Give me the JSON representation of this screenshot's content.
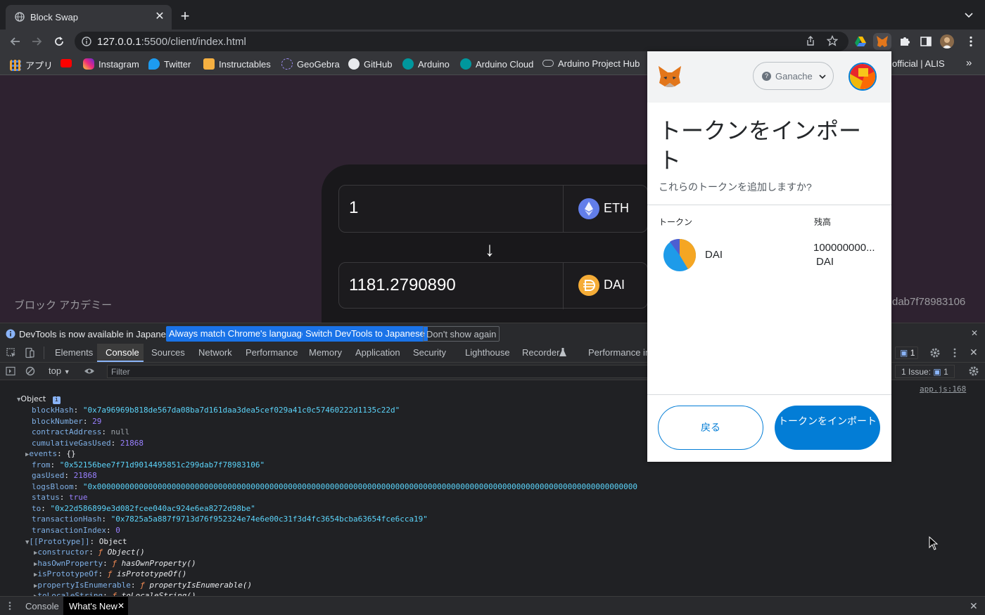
{
  "browser": {
    "tab_title": "Block Swap",
    "url_host": "127.0.0.1",
    "url_path": ":5500/client/index.html",
    "bookmarks": [
      "アプリ",
      "Instagram",
      "Twitter",
      "Instructables",
      "GeoGebra",
      "GitHub",
      "Arduino",
      "Arduino Cloud",
      "Arduino Project Hub"
    ],
    "bookmark_tail": "official | ALIS",
    "bookmark_overflow": "»"
  },
  "page": {
    "from_amount": "1",
    "from_token": "ETH",
    "to_amount": "1181.2790890",
    "to_token": "DAI",
    "brand": "ブロック アカデミー",
    "account_tail": "dab7f78983106",
    "swap_arrow": "↓"
  },
  "infobar": {
    "message": "DevTools is now available in Japanese!",
    "btn_match": "Always match Chrome's language",
    "btn_switch": "Switch DevTools to Japanese",
    "btn_dismiss": "Don't show again"
  },
  "devtools": {
    "tabs": [
      "Elements",
      "Console",
      "Sources",
      "Network",
      "Performance",
      "Memory",
      "Application",
      "Security",
      "Lighthouse",
      "Recorder",
      "Performance ins"
    ],
    "active_tab": "Console",
    "issues_badge": "1",
    "context": "top",
    "filter_placeholder": "Filter",
    "issues_text": "1 Issue:",
    "issues_count": "1",
    "source_link": "app.js:168",
    "object_label": "Object",
    "entries": [
      {
        "key": "blockHash",
        "val": "\"0x7a96969b818de567da08ba7d161daa3dea5cef029a41c0c57460222d1135c22d\"",
        "t": "s"
      },
      {
        "key": "blockNumber",
        "val": "29",
        "t": "n"
      },
      {
        "key": "contractAddress",
        "val": "null",
        "t": "nl"
      },
      {
        "key": "cumulativeGasUsed",
        "val": "21868",
        "t": "n"
      },
      {
        "key": "events",
        "val": "{}",
        "t": "ob"
      },
      {
        "key": "from",
        "val": "\"0x52156bee7f71d9014495851c299dab7f78983106\"",
        "t": "s"
      },
      {
        "key": "gasUsed",
        "val": "21868",
        "t": "n"
      },
      {
        "key": "logsBloom",
        "val": "\"0x00000000000000000000000000000000000000000000000000000000000000000000000000000000000000000000000000000000000000000000",
        "t": "s"
      },
      {
        "key": "status",
        "val": "true",
        "t": "n"
      },
      {
        "key": "to",
        "val": "\"0x22d586899e3d082fcee040ac924e6ea8272d98be\"",
        "t": "s"
      },
      {
        "key": "transactionHash",
        "val": "\"0x7825a5a887f9713d76f952324e74e6e00c31f3d4fc3654bcba63654fce6cca19\"",
        "t": "s"
      },
      {
        "key": "transactionIndex",
        "val": "0",
        "t": "n"
      }
    ],
    "prototype_label": "[[Prototype]]",
    "prototype_val": "Object",
    "proto_entries": [
      {
        "key": "constructor",
        "val": "Object()"
      },
      {
        "key": "hasOwnProperty",
        "val": "hasOwnProperty()"
      },
      {
        "key": "isPrototypeOf",
        "val": "isPrototypeOf()"
      },
      {
        "key": "propertyIsEnumerable",
        "val": "propertyIsEnumerable()"
      },
      {
        "key": "toLocaleString",
        "val": "toLocaleString()"
      }
    ],
    "drawer_tabs": [
      "Console",
      "What's New"
    ]
  },
  "metamask": {
    "network": "Ganache",
    "title": "トークンをインポート",
    "subtitle": "これらのトークンを追加しますか?",
    "col_token": "トークン",
    "col_balance": "残高",
    "token_symbol": "DAI",
    "token_balance": "100000000...",
    "token_balance_unit": "DAI",
    "btn_back": "戻る",
    "btn_import": "トークンをインポート"
  },
  "colors": {
    "metamask_blue": "#037dd6",
    "console_string": "#5cd5fb",
    "console_number": "#9980ff",
    "console_key": "#7fb0e6"
  }
}
